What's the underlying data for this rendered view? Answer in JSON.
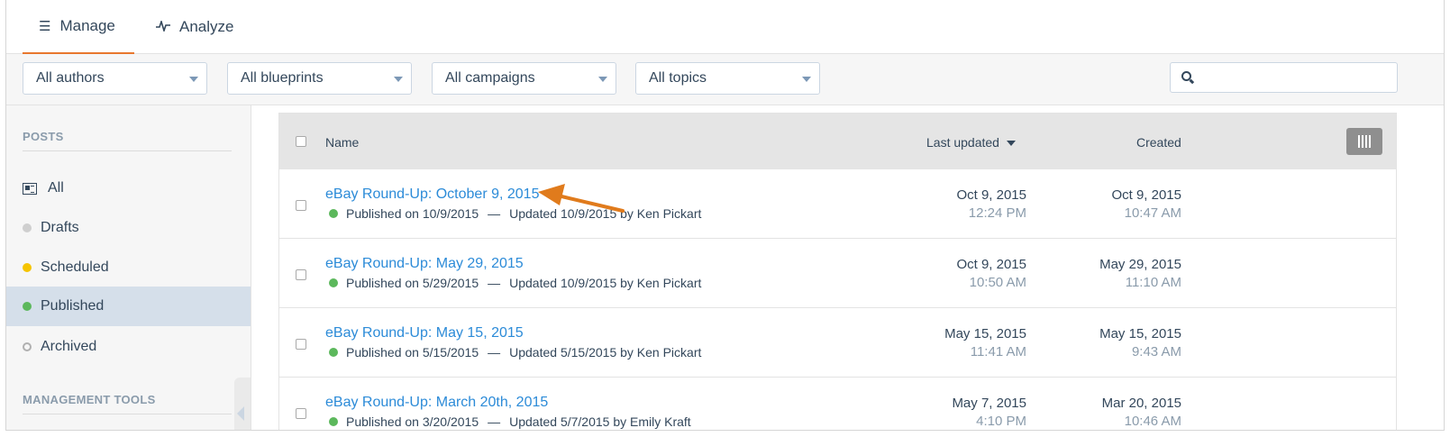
{
  "tabs": [
    {
      "label": "Manage",
      "icon": "list-icon"
    },
    {
      "label": "Analyze",
      "icon": "pulse-icon"
    }
  ],
  "filters": {
    "authors": "All authors",
    "blueprints": "All blueprints",
    "campaigns": "All campaigns",
    "topics": "All topics",
    "search_placeholder": ""
  },
  "sidebar": {
    "posts_heading": "POSTS",
    "items": [
      {
        "label": "All",
        "icon": "newspaper-icon"
      },
      {
        "label": "Drafts",
        "color": "#cfcfcf"
      },
      {
        "label": "Scheduled",
        "color": "#f5c400"
      },
      {
        "label": "Published",
        "color": "#5cb85c"
      },
      {
        "label": "Archived",
        "color": "#b0b0b0"
      }
    ],
    "tools_heading": "MANAGEMENT TOOLS"
  },
  "table": {
    "headers": {
      "name": "Name",
      "last_updated": "Last updated",
      "created": "Created"
    },
    "rows": [
      {
        "title": "eBay Round-Up: October 9, 2015",
        "published": "Published on 10/9/2015",
        "sep": "—",
        "updated": "Updated 10/9/2015 by Ken Pickart",
        "updated_date": "Oct 9, 2015",
        "updated_time": "12:24 PM",
        "created_date": "Oct 9, 2015",
        "created_time": "10:47 AM"
      },
      {
        "title": "eBay Round-Up: May 29, 2015",
        "published": "Published on 5/29/2015",
        "sep": "—",
        "updated": "Updated 10/9/2015 by Ken Pickart",
        "updated_date": "Oct 9, 2015",
        "updated_time": "10:50 AM",
        "created_date": "May 29, 2015",
        "created_time": "11:10 AM"
      },
      {
        "title": "eBay Round-Up: May 15, 2015",
        "published": "Published on 5/15/2015",
        "sep": "—",
        "updated": "Updated 5/15/2015 by Ken Pickart",
        "updated_date": "May 15, 2015",
        "updated_time": "11:41 AM",
        "created_date": "May 15, 2015",
        "created_time": "9:43 AM"
      },
      {
        "title": "eBay Round-Up: March 20th, 2015",
        "published": "Published on 3/20/2015",
        "sep": "—",
        "updated": "Updated 5/7/2015 by Emily Kraft",
        "updated_date": "May 7, 2015",
        "updated_time": "4:10 PM",
        "created_date": "Mar 20, 2015",
        "created_time": "10:46 AM"
      }
    ]
  },
  "colors": {
    "accent": "#e8772e",
    "link": "#2c8bd8",
    "published_dot": "#5cb85c",
    "arrow": "#e07b1c"
  }
}
